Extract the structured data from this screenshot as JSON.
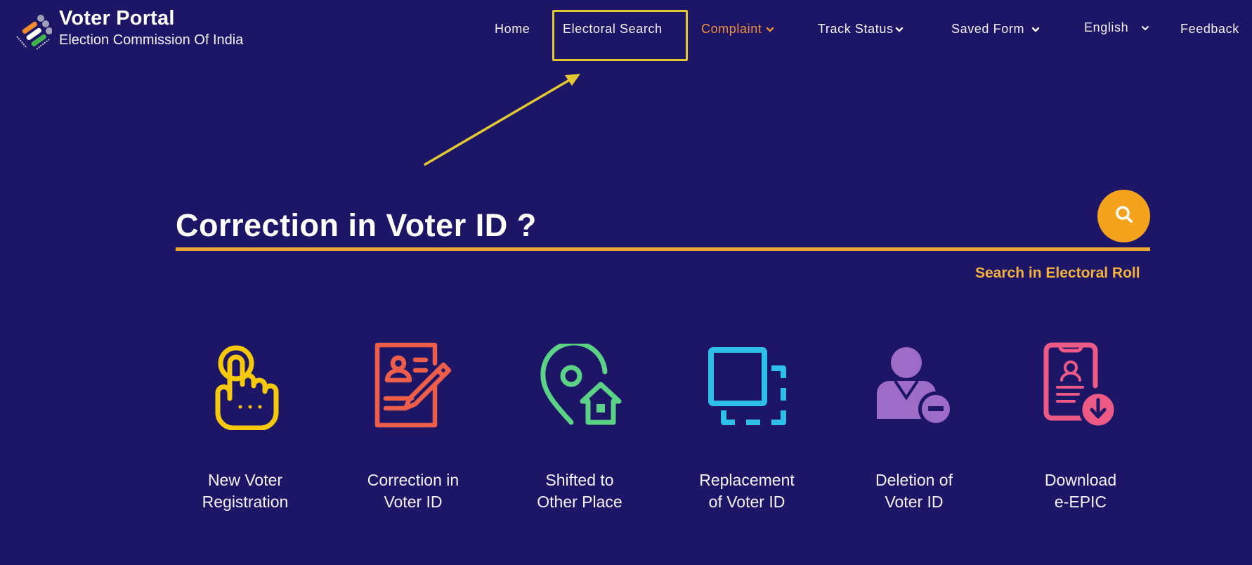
{
  "header": {
    "title": "Voter Portal",
    "subtitle": "Election Commission Of India"
  },
  "nav": {
    "items": [
      {
        "label": "Home",
        "has_dropdown": false
      },
      {
        "label": "Electoral Search",
        "has_dropdown": false,
        "highlighted": true
      },
      {
        "label": "Complaint",
        "has_dropdown": true,
        "color": "#f0903a"
      },
      {
        "label": "Track Status",
        "has_dropdown": true
      },
      {
        "label": "Saved Form",
        "has_dropdown": true
      },
      {
        "label": "English",
        "has_dropdown": true
      },
      {
        "label": "Feedback",
        "has_dropdown": false
      }
    ]
  },
  "annotation": {
    "highlight_color": "#e3c931",
    "arrow_target": "Electoral Search"
  },
  "search": {
    "heading": "Correction in Voter ID ?",
    "button_icon": "search-icon",
    "link": "Search in Electoral Roll",
    "accent": "#eea534"
  },
  "services": [
    {
      "line1": "New Voter",
      "line2": "Registration",
      "icon": "finger-touch-icon",
      "color": "#f7c90e"
    },
    {
      "line1": "Correction in",
      "line2": "Voter ID",
      "icon": "document-edit-icon",
      "color": "#ec5e4a"
    },
    {
      "line1": "Shifted to",
      "line2": "Other Place",
      "icon": "location-home-icon",
      "color": "#5bd286"
    },
    {
      "line1": "Replacement",
      "line2": "of Voter ID",
      "icon": "replace-card-icon",
      "color": "#2ec0e8"
    },
    {
      "line1": "Deletion of",
      "line2": "Voter ID",
      "icon": "user-remove-icon",
      "color": "#9c6cc7"
    },
    {
      "line1": "Download",
      "line2": "e-EPIC",
      "icon": "mobile-download-icon",
      "color": "#ee5a86"
    }
  ],
  "colors": {
    "background": "#1d1667",
    "accent_orange": "#f5a31c"
  }
}
